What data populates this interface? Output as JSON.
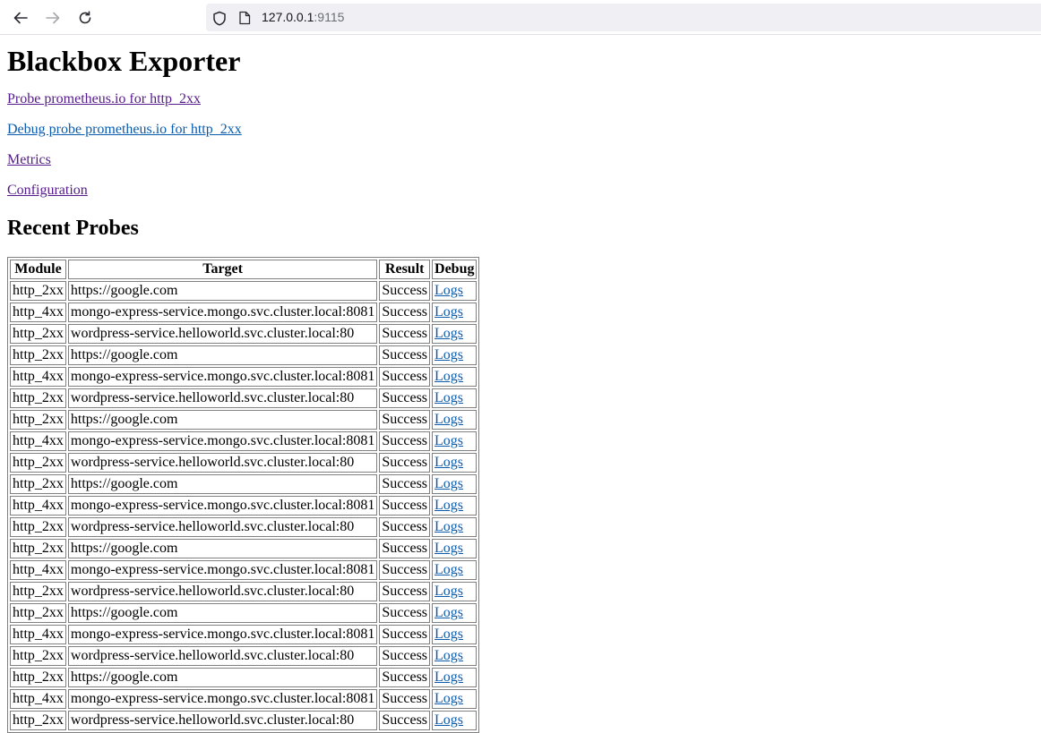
{
  "browser": {
    "url_host": "127.0.0.1",
    "url_port": ":9115"
  },
  "page": {
    "title": "Blackbox Exporter",
    "links": [
      "Probe prometheus.io for http_2xx",
      "Debug probe prometheus.io for http_2xx",
      "Metrics",
      "Configuration"
    ],
    "section_title": "Recent Probes"
  },
  "table": {
    "headers": [
      "Module",
      "Target",
      "Result",
      "Debug"
    ],
    "rows": [
      [
        "http_2xx",
        "https://google.com",
        "Success",
        "Logs"
      ],
      [
        "http_4xx",
        "mongo-express-service.mongo.svc.cluster.local:8081",
        "Success",
        "Logs"
      ],
      [
        "http_2xx",
        "wordpress-service.helloworld.svc.cluster.local:80",
        "Success",
        "Logs"
      ],
      [
        "http_2xx",
        "https://google.com",
        "Success",
        "Logs"
      ],
      [
        "http_4xx",
        "mongo-express-service.mongo.svc.cluster.local:8081",
        "Success",
        "Logs"
      ],
      [
        "http_2xx",
        "wordpress-service.helloworld.svc.cluster.local:80",
        "Success",
        "Logs"
      ],
      [
        "http_2xx",
        "https://google.com",
        "Success",
        "Logs"
      ],
      [
        "http_4xx",
        "mongo-express-service.mongo.svc.cluster.local:8081",
        "Success",
        "Logs"
      ],
      [
        "http_2xx",
        "wordpress-service.helloworld.svc.cluster.local:80",
        "Success",
        "Logs"
      ],
      [
        "http_2xx",
        "https://google.com",
        "Success",
        "Logs"
      ],
      [
        "http_4xx",
        "mongo-express-service.mongo.svc.cluster.local:8081",
        "Success",
        "Logs"
      ],
      [
        "http_2xx",
        "wordpress-service.helloworld.svc.cluster.local:80",
        "Success",
        "Logs"
      ],
      [
        "http_2xx",
        "https://google.com",
        "Success",
        "Logs"
      ],
      [
        "http_4xx",
        "mongo-express-service.mongo.svc.cluster.local:8081",
        "Success",
        "Logs"
      ],
      [
        "http_2xx",
        "wordpress-service.helloworld.svc.cluster.local:80",
        "Success",
        "Logs"
      ],
      [
        "http_2xx",
        "https://google.com",
        "Success",
        "Logs"
      ],
      [
        "http_4xx",
        "mongo-express-service.mongo.svc.cluster.local:8081",
        "Success",
        "Logs"
      ],
      [
        "http_2xx",
        "wordpress-service.helloworld.svc.cluster.local:80",
        "Success",
        "Logs"
      ],
      [
        "http_2xx",
        "https://google.com",
        "Success",
        "Logs"
      ],
      [
        "http_4xx",
        "mongo-express-service.mongo.svc.cluster.local:8081",
        "Success",
        "Logs"
      ],
      [
        "http_2xx",
        "wordpress-service.helloworld.svc.cluster.local:80",
        "Success",
        "Logs"
      ]
    ]
  },
  "icons": {
    "back": "back-arrow-icon",
    "forward": "forward-arrow-icon",
    "reload": "reload-icon",
    "shield": "tracking-shield-icon",
    "page": "page-icon"
  },
  "colors": {
    "visited_link": "#551a8b",
    "link": "#0b5cad"
  }
}
